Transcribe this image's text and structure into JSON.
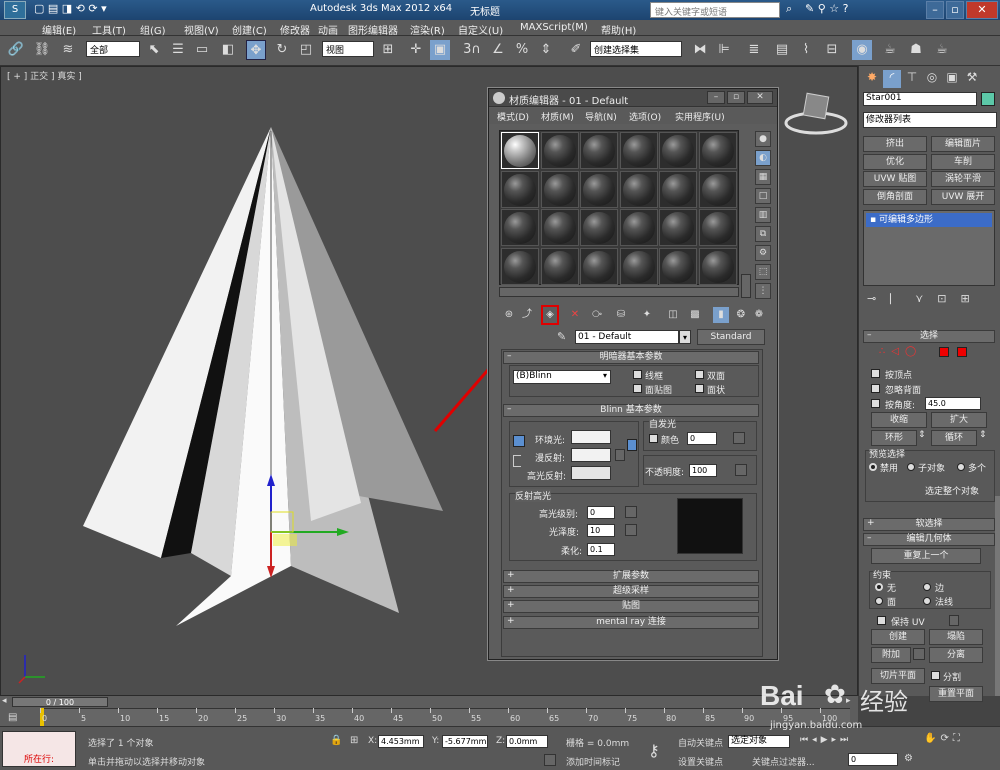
{
  "title_bar": {
    "app_title": "Autodesk 3ds Max  2012 x64",
    "doc_title": "无标题",
    "search_placeholder": "键入关键字或短语"
  },
  "menu": [
    "编辑(E)",
    "工具(T)",
    "组(G)",
    "视图(V)",
    "创建(C)",
    "修改器",
    "动画",
    "图形编辑器",
    "渲染(R)",
    "自定义(U)",
    "MAXScript(M)",
    "帮助(H)"
  ],
  "toolbar": {
    "selection_filter": "全部",
    "ref_coord": "视图",
    "named_selection": "创建选择集",
    "snap_label": "3"
  },
  "viewport": {
    "label": "[ + ] 正交 ] 真实 ]"
  },
  "material_editor": {
    "title": "材质编辑器 - 01 - Default",
    "menu": [
      "模式(D)",
      "材质(M)",
      "导航(N)",
      "选项(O)",
      "实用程序(U)"
    ],
    "material_name": "01 - Default",
    "material_type": "Standard",
    "shader_rollout": "明暗器基本参数",
    "shader": "(B)Blinn",
    "options": [
      "线框",
      "双面",
      "面贴图",
      "面状"
    ],
    "blinn_rollout": "Blinn 基本参数",
    "self_illum": "自发光",
    "color_label": "颜色",
    "color_value": "0",
    "ambient": "环境光:",
    "diffuse": "漫反射:",
    "specular": "高光反射:",
    "opacity_label": "不透明度:",
    "opacity_value": "100",
    "spec_highlights": "反射高光",
    "spec_level_label": "高光级别:",
    "spec_level": "0",
    "gloss_label": "光泽度:",
    "gloss": "10",
    "soften_label": "柔化:",
    "soften": "0.1",
    "rollouts": [
      "扩展参数",
      "超级采样",
      "贴图",
      "mental ray 连接"
    ]
  },
  "command_panel": {
    "object_name": "Star001",
    "modifier_list": "修改器列表",
    "buttons": [
      "挤出",
      "编辑面片",
      "优化",
      "车削",
      "UVW 贴图",
      "涡轮平滑",
      "倒角剖面",
      "UVW 展开"
    ],
    "stack_item": "可编辑多边形",
    "selection_rollout": "选择",
    "by_vertex": "按顶点",
    "ignore_backfacing": "忽略背面",
    "by_angle": "按角度:",
    "angle_value": "45.0",
    "shrink": "收缩",
    "grow": "扩大",
    "ring": "环形",
    "loop": "循环",
    "preview_selection": "预览选择",
    "preview_options": [
      "禁用",
      "子对象",
      "多个"
    ],
    "select_whole": "选定整个对象",
    "soft_selection": "软选择",
    "edit_geometry": "编辑几何体",
    "repeat_last": "重复上一个",
    "constraints": "约束",
    "constraint_options": [
      "无",
      "边",
      "面",
      "法线"
    ],
    "preserve_uv": "保持 UV",
    "create": "创建",
    "collapse": "塌陷",
    "attach": "附加",
    "detach": "分离",
    "slice_plane": "切片平面",
    "split": "分割",
    "slice": "切片",
    "reset_plane": "重置平面",
    "quickslice": "快速切片",
    "cut": "切割"
  },
  "timeline": {
    "frame": "0 / 100",
    "ticks": [
      "0",
      "5",
      "10",
      "15",
      "20",
      "25",
      "30",
      "35",
      "40",
      "45",
      "50",
      "55",
      "60",
      "65",
      "70",
      "75",
      "80",
      "85",
      "90",
      "95",
      "100"
    ]
  },
  "status": {
    "left_label": "所在行:",
    "message1": "选择了 1 个对象",
    "message2": "单击并拖动以选择并移动对象",
    "x_value": "4.453mm",
    "y_value": "-5.677mm",
    "z_value": "0.0mm",
    "grid": "栅格 = 0.0mm",
    "add_time_tag": "添加时间标记",
    "auto_key": "自动关键点",
    "selected": "选定对象",
    "set_key": "设置关键点",
    "key_filters": "关键点过滤器...",
    "frame_value": "0"
  },
  "watermark": {
    "brand": "Bai",
    "brand2": "经验",
    "url": "jingyan.baidu.com"
  },
  "colors": {
    "highlight_box": "#e00000",
    "arrow": "#e00000",
    "stack_bg": "#3c6cc8"
  }
}
